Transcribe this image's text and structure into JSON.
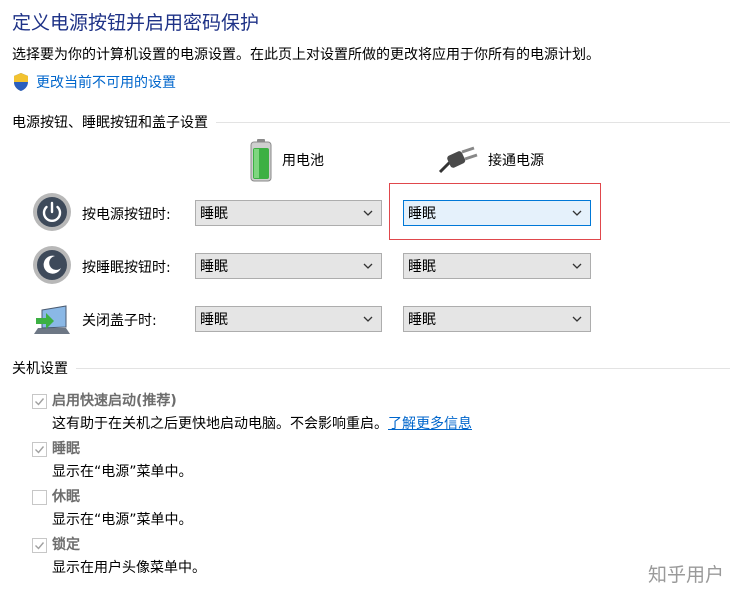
{
  "header": {
    "title": "定义电源按钮并启用密码保护",
    "description": "选择要为你的计算机设置的电源设置。在此页上对设置所做的更改将应用于你所有的电源计划。",
    "change_link": "更改当前不可用的设置",
    "change_link_icon": "uac-shield-icon"
  },
  "power_section": {
    "title": "电源按钮、睡眠按钮和盖子设置",
    "columns": [
      {
        "label": "用电池",
        "icon": "battery-icon"
      },
      {
        "label": "接通电源",
        "icon": "power-plug-icon"
      }
    ],
    "rows": [
      {
        "label": "按电源按钮时:",
        "icon": "power-button-icon",
        "battery": "睡眠",
        "plugged": "睡眠"
      },
      {
        "label": "按睡眠按钮时:",
        "icon": "sleep-button-icon",
        "battery": "睡眠",
        "plugged": "睡眠"
      },
      {
        "label": "关闭盖子时:",
        "icon": "laptop-lid-icon",
        "battery": "睡眠",
        "plugged": "睡眠"
      }
    ]
  },
  "shutdown_section": {
    "title": "关机设置",
    "items": [
      {
        "label": "启用快速启动(推荐)",
        "desc": "这有助于在关机之后更快地启动电脑。不会影响重启。",
        "more_link": "了解更多信息",
        "checked": true,
        "enabled": false
      },
      {
        "label": "睡眠",
        "desc": "显示在“电源”菜单中。",
        "checked": true,
        "enabled": false
      },
      {
        "label": "休眠",
        "desc": "显示在“电源”菜单中。",
        "checked": false,
        "enabled": false
      },
      {
        "label": "锁定",
        "desc": "显示在用户头像菜单中。",
        "checked": true,
        "enabled": false
      }
    ]
  },
  "watermark": "知乎用户",
  "colors": {
    "title": "#1e3287",
    "link": "#0066cc",
    "highlight": "#e0474c",
    "battery_green": "#3cb043"
  }
}
